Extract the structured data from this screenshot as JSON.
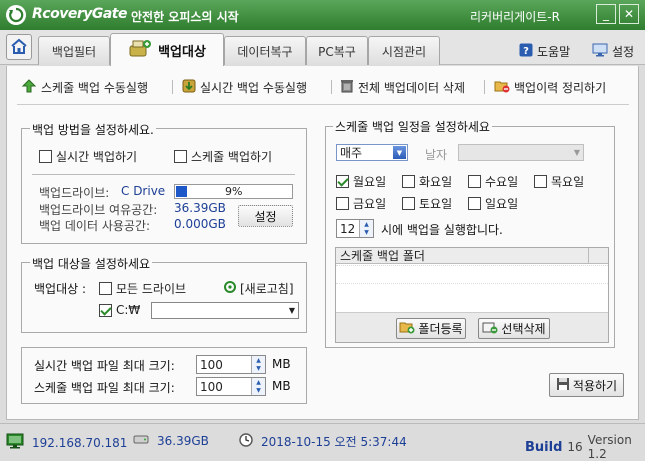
{
  "window": {
    "brand": "RcoveryGate",
    "slogan": "안전한 오피스의 시작",
    "title": "리커버리게이트-R",
    "minimize": "_",
    "close": "✕"
  },
  "tabs": [
    "백업필터",
    "백업대상",
    "데이터복구",
    "PC복구",
    "시점관리"
  ],
  "top_links": {
    "help": "도움말",
    "settings": "설정"
  },
  "actions": {
    "schedule_manual": "스케줄 백업 수동실행",
    "realtime_manual": "실시간 백업 수동실행",
    "delete_all": "전체 백업데이터 삭제",
    "cleanup_history": "백업이력 정리하기"
  },
  "backup_method": {
    "title": "백업 방법을 설정하세요.",
    "realtime_label": "실시간 백업하기",
    "schedule_label": "스케줄 백업하기",
    "drive_label": "백업드라이브:",
    "drive_value": "C Drive",
    "progress_text": "9%",
    "progress_value": 0.09,
    "free_label": "백업드라이브 여유공간:",
    "free_value": "36.39GB",
    "used_label": "백업 데이터   사용공간:",
    "used_value": "0.000GB",
    "settings_btn": "설정"
  },
  "backup_target": {
    "title": "백업 대상을 설정하세요",
    "target_label": "백업대상 :",
    "all_drives": "모든 드라이브",
    "refresh": "[새로고침]",
    "drive": "C:₩",
    "path_value": ""
  },
  "limits": {
    "realtime_label": "실시간 백업 파일 최대 크기:",
    "realtime_value": "100",
    "schedule_label": "스케줄 백업 파일 최대 크기:",
    "schedule_value": "100",
    "unit": "MB"
  },
  "schedule": {
    "title": "스케줄 백업 일정을 설정하세요",
    "frequency": "매주",
    "date_label": "날자",
    "date_value": "",
    "days": [
      {
        "label": "월요일",
        "checked": true
      },
      {
        "label": "화요일",
        "checked": false
      },
      {
        "label": "수요일",
        "checked": false
      },
      {
        "label": "목요일",
        "checked": false
      },
      {
        "label": "금요일",
        "checked": false
      },
      {
        "label": "토요일",
        "checked": false
      },
      {
        "label": "일요일",
        "checked": false
      }
    ],
    "hour": "12",
    "hour_text": "시에 백업을 실행합니다.",
    "folder_header": "스케줄 백업 폴더",
    "add_folder": "폴더등록",
    "delete_selected": "선택삭제"
  },
  "apply_btn": "적용하기",
  "status": {
    "ip": "192.168.70.181",
    "disk": "36.39GB",
    "datetime": "2018-10-15 오전 5:37:44",
    "build_label": "Build",
    "build_no": "16",
    "version": "Version 1.2"
  },
  "colors": {
    "title_green": "#2f7d2f",
    "text_blue": "#1d3f96",
    "progress_blue": "#1e58c8"
  }
}
